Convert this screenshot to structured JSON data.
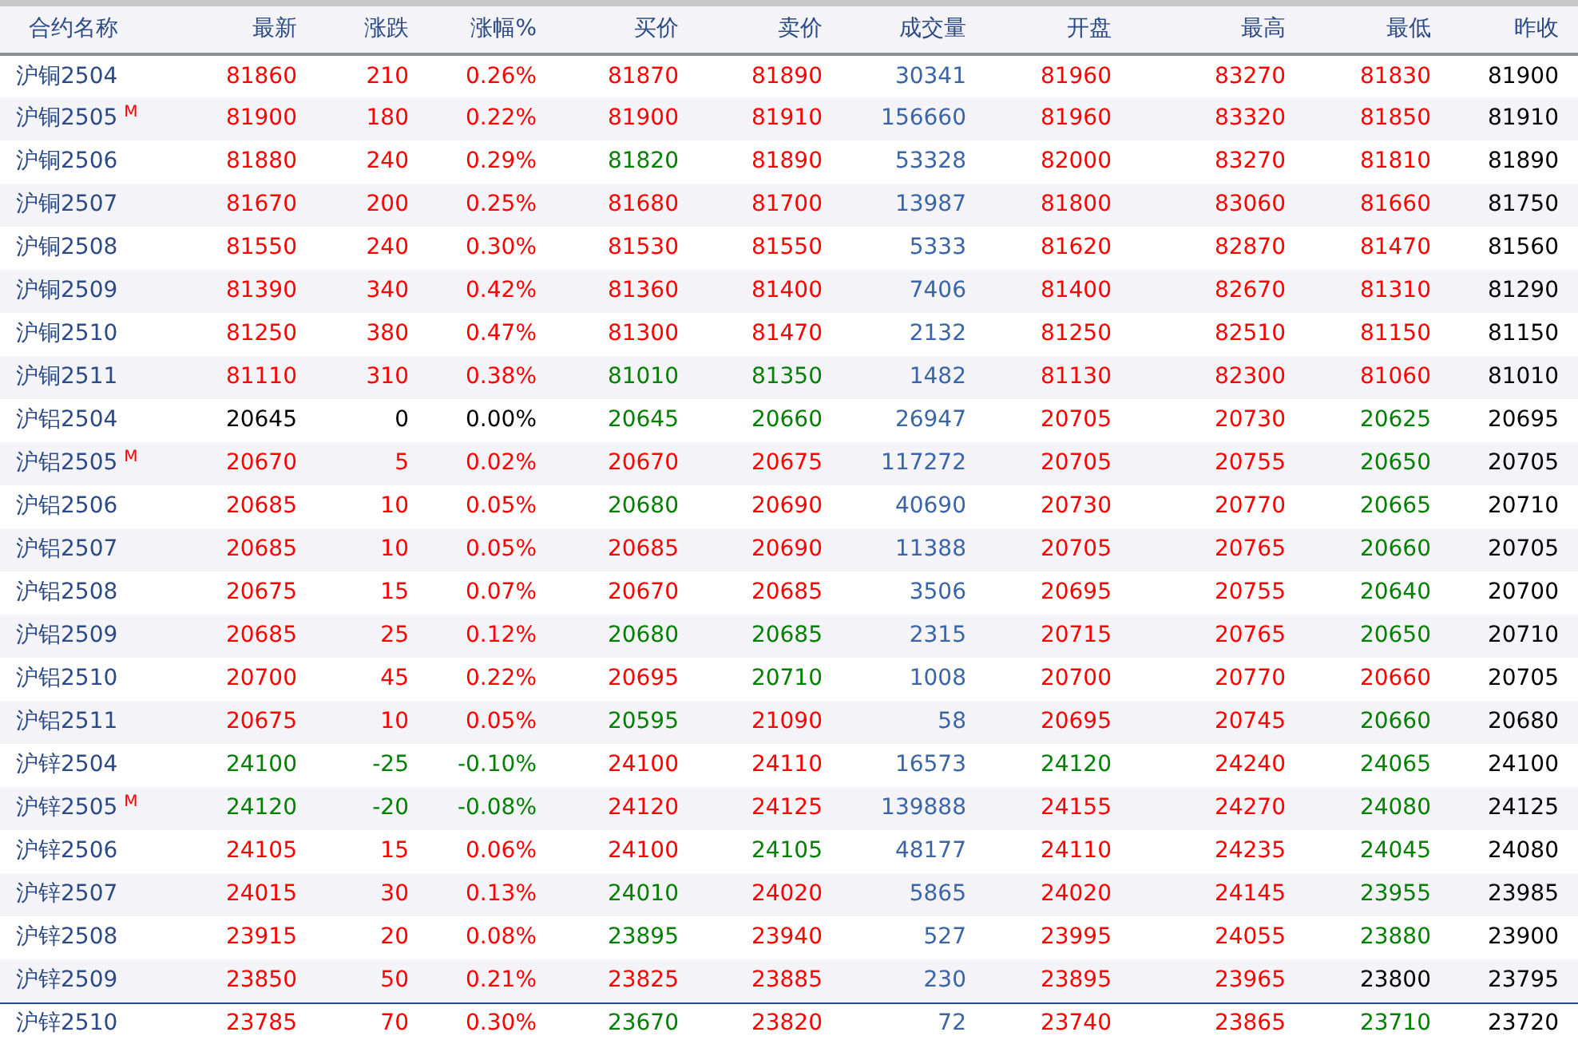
{
  "columns": [
    "合约名称",
    "最新",
    "涨跌",
    "涨幅%",
    "买价",
    "卖价",
    "成交量",
    "开盘",
    "最高",
    "最低",
    "昨收"
  ],
  "rows": [
    {
      "name": "沪铜2504",
      "selected": false,
      "cells": [
        {
          "text": "81860",
          "color": "#ff0000"
        },
        {
          "text": "210",
          "color": "#ff0000"
        },
        {
          "text": "0.26%",
          "color": "#ff0000"
        },
        {
          "text": "81870",
          "color": "#ff0000"
        },
        {
          "text": "81890",
          "color": "#ff0000"
        },
        {
          "text": "30341",
          "color": "#3a64a8"
        },
        {
          "text": "81960",
          "color": "#ff0000"
        },
        {
          "text": "83270",
          "color": "#ff0000"
        },
        {
          "text": "81830",
          "color": "#ff0000"
        },
        {
          "text": "81900",
          "color": "#000000"
        }
      ]
    },
    {
      "name": "沪铜2505",
      "mark": "M",
      "selected": false,
      "cells": [
        {
          "text": "81900",
          "color": "#ff0000"
        },
        {
          "text": "180",
          "color": "#ff0000"
        },
        {
          "text": "0.22%",
          "color": "#ff0000"
        },
        {
          "text": "81900",
          "color": "#ff0000"
        },
        {
          "text": "81910",
          "color": "#ff0000"
        },
        {
          "text": "156660",
          "color": "#3a64a8"
        },
        {
          "text": "81960",
          "color": "#ff0000"
        },
        {
          "text": "83320",
          "color": "#ff0000"
        },
        {
          "text": "81850",
          "color": "#ff0000"
        },
        {
          "text": "81910",
          "color": "#000000"
        }
      ]
    },
    {
      "name": "沪铜2506",
      "selected": false,
      "cells": [
        {
          "text": "81880",
          "color": "#ff0000"
        },
        {
          "text": "240",
          "color": "#ff0000"
        },
        {
          "text": "0.29%",
          "color": "#ff0000"
        },
        {
          "text": "81820",
          "color": "#008000"
        },
        {
          "text": "81890",
          "color": "#ff0000"
        },
        {
          "text": "53328",
          "color": "#3a64a8"
        },
        {
          "text": "82000",
          "color": "#ff0000"
        },
        {
          "text": "83270",
          "color": "#ff0000"
        },
        {
          "text": "81810",
          "color": "#ff0000"
        },
        {
          "text": "81890",
          "color": "#000000"
        }
      ]
    },
    {
      "name": "沪铜2507",
      "selected": false,
      "cells": [
        {
          "text": "81670",
          "color": "#ff0000"
        },
        {
          "text": "200",
          "color": "#ff0000"
        },
        {
          "text": "0.25%",
          "color": "#ff0000"
        },
        {
          "text": "81680",
          "color": "#ff0000"
        },
        {
          "text": "81700",
          "color": "#ff0000"
        },
        {
          "text": "13987",
          "color": "#3a64a8"
        },
        {
          "text": "81800",
          "color": "#ff0000"
        },
        {
          "text": "83060",
          "color": "#ff0000"
        },
        {
          "text": "81660",
          "color": "#ff0000"
        },
        {
          "text": "81750",
          "color": "#000000"
        }
      ]
    },
    {
      "name": "沪铜2508",
      "selected": false,
      "cells": [
        {
          "text": "81550",
          "color": "#ff0000"
        },
        {
          "text": "240",
          "color": "#ff0000"
        },
        {
          "text": "0.30%",
          "color": "#ff0000"
        },
        {
          "text": "81530",
          "color": "#ff0000"
        },
        {
          "text": "81550",
          "color": "#ff0000"
        },
        {
          "text": "5333",
          "color": "#3a64a8"
        },
        {
          "text": "81620",
          "color": "#ff0000"
        },
        {
          "text": "82870",
          "color": "#ff0000"
        },
        {
          "text": "81470",
          "color": "#ff0000"
        },
        {
          "text": "81560",
          "color": "#000000"
        }
      ]
    },
    {
      "name": "沪铜2509",
      "selected": false,
      "cells": [
        {
          "text": "81390",
          "color": "#ff0000"
        },
        {
          "text": "340",
          "color": "#ff0000"
        },
        {
          "text": "0.42%",
          "color": "#ff0000"
        },
        {
          "text": "81360",
          "color": "#ff0000"
        },
        {
          "text": "81400",
          "color": "#ff0000"
        },
        {
          "text": "7406",
          "color": "#3a64a8"
        },
        {
          "text": "81400",
          "color": "#ff0000"
        },
        {
          "text": "82670",
          "color": "#ff0000"
        },
        {
          "text": "81310",
          "color": "#ff0000"
        },
        {
          "text": "81290",
          "color": "#000000"
        }
      ]
    },
    {
      "name": "沪铜2510",
      "selected": false,
      "cells": [
        {
          "text": "81250",
          "color": "#ff0000"
        },
        {
          "text": "380",
          "color": "#ff0000"
        },
        {
          "text": "0.47%",
          "color": "#ff0000"
        },
        {
          "text": "81300",
          "color": "#ff0000"
        },
        {
          "text": "81470",
          "color": "#ff0000"
        },
        {
          "text": "2132",
          "color": "#3a64a8"
        },
        {
          "text": "81250",
          "color": "#ff0000"
        },
        {
          "text": "82510",
          "color": "#ff0000"
        },
        {
          "text": "81150",
          "color": "#ff0000"
        },
        {
          "text": "81150",
          "color": "#000000"
        }
      ]
    },
    {
      "name": "沪铜2511",
      "selected": false,
      "cells": [
        {
          "text": "81110",
          "color": "#ff0000"
        },
        {
          "text": "310",
          "color": "#ff0000"
        },
        {
          "text": "0.38%",
          "color": "#ff0000"
        },
        {
          "text": "81010",
          "color": "#008000"
        },
        {
          "text": "81350",
          "color": "#008000"
        },
        {
          "text": "1482",
          "color": "#3a64a8"
        },
        {
          "text": "81130",
          "color": "#ff0000"
        },
        {
          "text": "82300",
          "color": "#ff0000"
        },
        {
          "text": "81060",
          "color": "#ff0000"
        },
        {
          "text": "81010",
          "color": "#000000"
        }
      ]
    },
    {
      "name": "沪铝2504",
      "selected": false,
      "cells": [
        {
          "text": "20645",
          "color": "#000000"
        },
        {
          "text": "0",
          "color": "#000000"
        },
        {
          "text": "0.00%",
          "color": "#000000"
        },
        {
          "text": "20645",
          "color": "#008000"
        },
        {
          "text": "20660",
          "color": "#008000"
        },
        {
          "text": "26947",
          "color": "#3a64a8"
        },
        {
          "text": "20705",
          "color": "#ff0000"
        },
        {
          "text": "20730",
          "color": "#ff0000"
        },
        {
          "text": "20625",
          "color": "#008000"
        },
        {
          "text": "20695",
          "color": "#000000"
        }
      ]
    },
    {
      "name": "沪铝2505",
      "mark": "M",
      "selected": false,
      "cells": [
        {
          "text": "20670",
          "color": "#ff0000"
        },
        {
          "text": "5",
          "color": "#ff0000"
        },
        {
          "text": "0.02%",
          "color": "#ff0000"
        },
        {
          "text": "20670",
          "color": "#ff0000"
        },
        {
          "text": "20675",
          "color": "#ff0000"
        },
        {
          "text": "117272",
          "color": "#3a64a8"
        },
        {
          "text": "20705",
          "color": "#ff0000"
        },
        {
          "text": "20755",
          "color": "#ff0000"
        },
        {
          "text": "20650",
          "color": "#008000"
        },
        {
          "text": "20705",
          "color": "#000000"
        }
      ]
    },
    {
      "name": "沪铝2506",
      "selected": false,
      "cells": [
        {
          "text": "20685",
          "color": "#ff0000"
        },
        {
          "text": "10",
          "color": "#ff0000"
        },
        {
          "text": "0.05%",
          "color": "#ff0000"
        },
        {
          "text": "20680",
          "color": "#008000"
        },
        {
          "text": "20690",
          "color": "#ff0000"
        },
        {
          "text": "40690",
          "color": "#3a64a8"
        },
        {
          "text": "20730",
          "color": "#ff0000"
        },
        {
          "text": "20770",
          "color": "#ff0000"
        },
        {
          "text": "20665",
          "color": "#008000"
        },
        {
          "text": "20710",
          "color": "#000000"
        }
      ]
    },
    {
      "name": "沪铝2507",
      "selected": false,
      "cells": [
        {
          "text": "20685",
          "color": "#ff0000"
        },
        {
          "text": "10",
          "color": "#ff0000"
        },
        {
          "text": "0.05%",
          "color": "#ff0000"
        },
        {
          "text": "20685",
          "color": "#ff0000"
        },
        {
          "text": "20690",
          "color": "#ff0000"
        },
        {
          "text": "11388",
          "color": "#3a64a8"
        },
        {
          "text": "20705",
          "color": "#ff0000"
        },
        {
          "text": "20765",
          "color": "#ff0000"
        },
        {
          "text": "20660",
          "color": "#008000"
        },
        {
          "text": "20705",
          "color": "#000000"
        }
      ]
    },
    {
      "name": "沪铝2508",
      "selected": false,
      "cells": [
        {
          "text": "20675",
          "color": "#ff0000"
        },
        {
          "text": "15",
          "color": "#ff0000"
        },
        {
          "text": "0.07%",
          "color": "#ff0000"
        },
        {
          "text": "20670",
          "color": "#ff0000"
        },
        {
          "text": "20685",
          "color": "#ff0000"
        },
        {
          "text": "3506",
          "color": "#3a64a8"
        },
        {
          "text": "20695",
          "color": "#ff0000"
        },
        {
          "text": "20755",
          "color": "#ff0000"
        },
        {
          "text": "20640",
          "color": "#008000"
        },
        {
          "text": "20700",
          "color": "#000000"
        }
      ]
    },
    {
      "name": "沪铝2509",
      "selected": false,
      "cells": [
        {
          "text": "20685",
          "color": "#ff0000"
        },
        {
          "text": "25",
          "color": "#ff0000"
        },
        {
          "text": "0.12%",
          "color": "#ff0000"
        },
        {
          "text": "20680",
          "color": "#008000"
        },
        {
          "text": "20685",
          "color": "#008000"
        },
        {
          "text": "2315",
          "color": "#3a64a8"
        },
        {
          "text": "20715",
          "color": "#ff0000"
        },
        {
          "text": "20765",
          "color": "#ff0000"
        },
        {
          "text": "20650",
          "color": "#008000"
        },
        {
          "text": "20710",
          "color": "#000000"
        }
      ]
    },
    {
      "name": "沪铝2510",
      "selected": false,
      "cells": [
        {
          "text": "20700",
          "color": "#ff0000"
        },
        {
          "text": "45",
          "color": "#ff0000"
        },
        {
          "text": "0.22%",
          "color": "#ff0000"
        },
        {
          "text": "20695",
          "color": "#ff0000"
        },
        {
          "text": "20710",
          "color": "#008000"
        },
        {
          "text": "1008",
          "color": "#3a64a8"
        },
        {
          "text": "20700",
          "color": "#ff0000"
        },
        {
          "text": "20770",
          "color": "#ff0000"
        },
        {
          "text": "20660",
          "color": "#ff0000"
        },
        {
          "text": "20705",
          "color": "#000000"
        }
      ]
    },
    {
      "name": "沪铝2511",
      "selected": false,
      "cells": [
        {
          "text": "20675",
          "color": "#ff0000"
        },
        {
          "text": "10",
          "color": "#ff0000"
        },
        {
          "text": "0.05%",
          "color": "#ff0000"
        },
        {
          "text": "20595",
          "color": "#008000"
        },
        {
          "text": "21090",
          "color": "#ff0000"
        },
        {
          "text": "58",
          "color": "#3a64a8"
        },
        {
          "text": "20695",
          "color": "#ff0000"
        },
        {
          "text": "20745",
          "color": "#ff0000"
        },
        {
          "text": "20660",
          "color": "#008000"
        },
        {
          "text": "20680",
          "color": "#000000"
        }
      ]
    },
    {
      "name": "沪锌2504",
      "selected": false,
      "cells": [
        {
          "text": "24100",
          "color": "#008000"
        },
        {
          "text": "-25",
          "color": "#008000"
        },
        {
          "text": "-0.10%",
          "color": "#008000"
        },
        {
          "text": "24100",
          "color": "#ff0000"
        },
        {
          "text": "24110",
          "color": "#ff0000"
        },
        {
          "text": "16573",
          "color": "#3a64a8"
        },
        {
          "text": "24120",
          "color": "#008000"
        },
        {
          "text": "24240",
          "color": "#ff0000"
        },
        {
          "text": "24065",
          "color": "#008000"
        },
        {
          "text": "24100",
          "color": "#000000"
        }
      ]
    },
    {
      "name": "沪锌2505",
      "mark": "M",
      "selected": false,
      "cells": [
        {
          "text": "24120",
          "color": "#008000"
        },
        {
          "text": "-20",
          "color": "#008000"
        },
        {
          "text": "-0.08%",
          "color": "#008000"
        },
        {
          "text": "24120",
          "color": "#ff0000"
        },
        {
          "text": "24125",
          "color": "#ff0000"
        },
        {
          "text": "139888",
          "color": "#3a64a8"
        },
        {
          "text": "24155",
          "color": "#ff0000"
        },
        {
          "text": "24270",
          "color": "#ff0000"
        },
        {
          "text": "24080",
          "color": "#008000"
        },
        {
          "text": "24125",
          "color": "#000000"
        }
      ]
    },
    {
      "name": "沪锌2506",
      "selected": false,
      "cells": [
        {
          "text": "24105",
          "color": "#ff0000"
        },
        {
          "text": "15",
          "color": "#ff0000"
        },
        {
          "text": "0.06%",
          "color": "#ff0000"
        },
        {
          "text": "24100",
          "color": "#ff0000"
        },
        {
          "text": "24105",
          "color": "#008000"
        },
        {
          "text": "48177",
          "color": "#3a64a8"
        },
        {
          "text": "24110",
          "color": "#ff0000"
        },
        {
          "text": "24235",
          "color": "#ff0000"
        },
        {
          "text": "24045",
          "color": "#008000"
        },
        {
          "text": "24080",
          "color": "#000000"
        }
      ]
    },
    {
      "name": "沪锌2507",
      "selected": false,
      "cells": [
        {
          "text": "24015",
          "color": "#ff0000"
        },
        {
          "text": "30",
          "color": "#ff0000"
        },
        {
          "text": "0.13%",
          "color": "#ff0000"
        },
        {
          "text": "24010",
          "color": "#008000"
        },
        {
          "text": "24020",
          "color": "#ff0000"
        },
        {
          "text": "5865",
          "color": "#3a64a8"
        },
        {
          "text": "24020",
          "color": "#ff0000"
        },
        {
          "text": "24145",
          "color": "#ff0000"
        },
        {
          "text": "23955",
          "color": "#008000"
        },
        {
          "text": "23985",
          "color": "#000000"
        }
      ]
    },
    {
      "name": "沪锌2508",
      "selected": false,
      "cells": [
        {
          "text": "23915",
          "color": "#ff0000"
        },
        {
          "text": "20",
          "color": "#ff0000"
        },
        {
          "text": "0.08%",
          "color": "#ff0000"
        },
        {
          "text": "23895",
          "color": "#008000"
        },
        {
          "text": "23940",
          "color": "#ff0000"
        },
        {
          "text": "527",
          "color": "#3a64a8"
        },
        {
          "text": "23995",
          "color": "#ff0000"
        },
        {
          "text": "24055",
          "color": "#ff0000"
        },
        {
          "text": "23880",
          "color": "#008000"
        },
        {
          "text": "23900",
          "color": "#000000"
        }
      ]
    },
    {
      "name": "沪锌2509",
      "selected": false,
      "cells": [
        {
          "text": "23850",
          "color": "#ff0000"
        },
        {
          "text": "50",
          "color": "#ff0000"
        },
        {
          "text": "0.21%",
          "color": "#ff0000"
        },
        {
          "text": "23825",
          "color": "#ff0000"
        },
        {
          "text": "23885",
          "color": "#ff0000"
        },
        {
          "text": "230",
          "color": "#3a64a8"
        },
        {
          "text": "23895",
          "color": "#ff0000"
        },
        {
          "text": "23965",
          "color": "#ff0000"
        },
        {
          "text": "23800",
          "color": "#000000"
        },
        {
          "text": "23795",
          "color": "#000000"
        }
      ]
    },
    {
      "name": "沪锌2510",
      "selected": true,
      "cells": [
        {
          "text": "23785",
          "color": "#ff0000"
        },
        {
          "text": "70",
          "color": "#ff0000"
        },
        {
          "text": "0.30%",
          "color": "#ff0000"
        },
        {
          "text": "23670",
          "color": "#008000"
        },
        {
          "text": "23820",
          "color": "#ff0000"
        },
        {
          "text": "72",
          "color": "#3a64a8"
        },
        {
          "text": "23740",
          "color": "#ff0000"
        },
        {
          "text": "23865",
          "color": "#ff0000"
        },
        {
          "text": "23710",
          "color": "#008000"
        },
        {
          "text": "23720",
          "color": "#000000"
        }
      ]
    }
  ]
}
